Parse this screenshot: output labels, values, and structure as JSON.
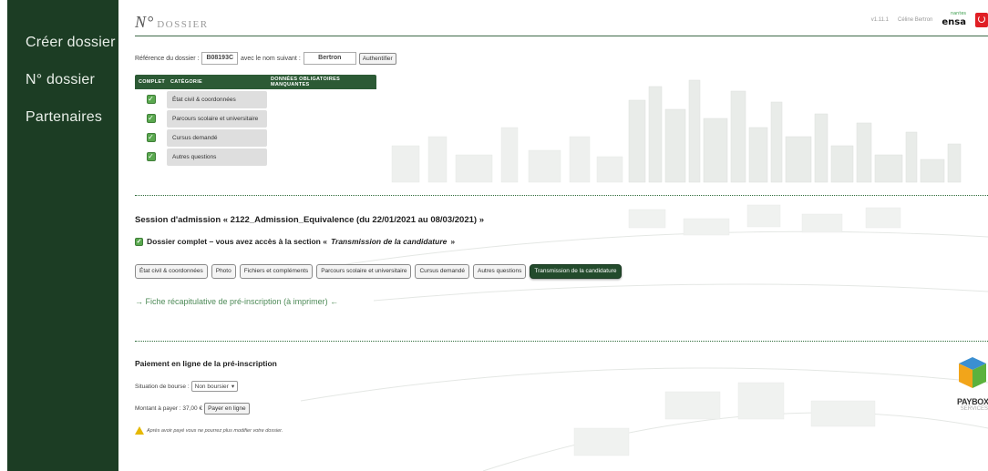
{
  "sidebar": {
    "items": [
      {
        "label": "Créer dossier"
      },
      {
        "label": "N° dossier"
      },
      {
        "label": "Partenaires"
      }
    ]
  },
  "header": {
    "title_prefix": "N°",
    "title_rest": "DOSSIER",
    "version": "v1.11.1",
    "user": "Céline Bertron",
    "logo_text": "ensa",
    "logo_sub": "nantes"
  },
  "reference": {
    "label": "Référence du dossier :",
    "value": "B08193C",
    "name_label": "avec le nom suivant :",
    "name_value": "Bertron",
    "auth_button": "Authentifier"
  },
  "category_table": {
    "headers": [
      "Complet",
      "Catégorie",
      "Données obligatoires manquantes"
    ],
    "rows": [
      {
        "label": "État civil & coordonnées",
        "complete": true
      },
      {
        "label": "Parcours scolaire et universitaire",
        "complete": true
      },
      {
        "label": "Cursus demandé",
        "complete": true
      },
      {
        "label": "Autres questions",
        "complete": true
      }
    ]
  },
  "session": {
    "title": "Session d'admission « 2122_Admission_Equivalence (du 22/01/2021 au 08/03/2021) »",
    "complete_text": "Dossier complet – vous avez accès à la section «",
    "complete_link": "Transmission de la candidature",
    "complete_end": "»"
  },
  "tabs": [
    {
      "label": "État civil & coordonnées",
      "active": false
    },
    {
      "label": "Photo",
      "active": false
    },
    {
      "label": "Fichiers et compléments",
      "active": false
    },
    {
      "label": "Parcours scolaire et universitaire",
      "active": false
    },
    {
      "label": "Cursus demandé",
      "active": false
    },
    {
      "label": "Autres questions",
      "active": false
    },
    {
      "label": "Transmission de la candidature",
      "active": true
    }
  ],
  "fiche_link": "→ Fiche récapitulative de pré-inscription (à imprimer) ←",
  "payment": {
    "title": "Paiement en ligne de la pré-inscription",
    "bourse_label": "Situation de bourse :",
    "bourse_value": "Non boursier",
    "amount_label": "Montant à payer : 37,00 €",
    "pay_button": "Payer en ligne",
    "warning": "Après avoir payé vous ne pourrez plus modifier votre dossier."
  },
  "paybox": {
    "name": "PAYBOX",
    "sub": "SERVICES"
  },
  "colors": {
    "sidebar_bg": "#1c3d24",
    "accent_green": "#2c5a35",
    "active_tab": "#234b2c",
    "link_green": "#4d8a57"
  }
}
